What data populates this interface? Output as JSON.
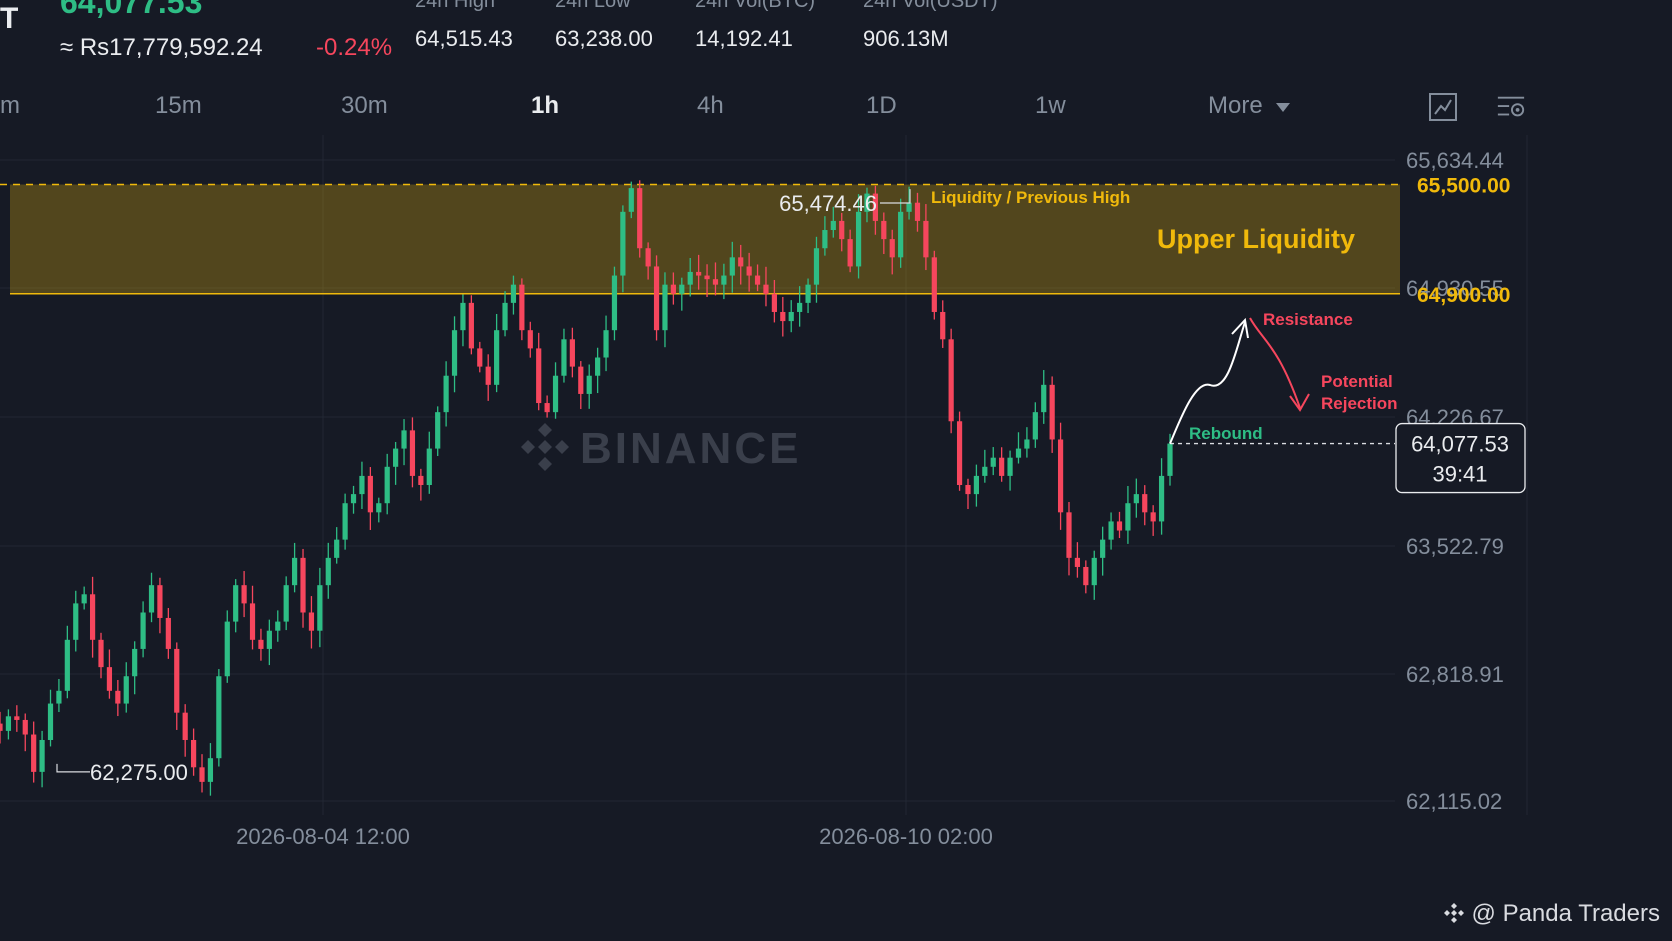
{
  "header": {
    "symbol_fragment": "T",
    "last_price": "64,077.53",
    "converted_price": "≈ Rs17,779,592.24",
    "change_percent": "-0.24%",
    "stats": [
      {
        "label": "24h High",
        "value": "64,515.43"
      },
      {
        "label": "24h Low",
        "value": "63,238.00"
      },
      {
        "label": "24h Vol(BTC)",
        "value": "14,192.41"
      },
      {
        "label": "24h Vol(USDT)",
        "value": "906.13M"
      }
    ]
  },
  "timeframes": {
    "items": [
      "m",
      "15m",
      "30m",
      "1h",
      "4h",
      "1D",
      "1w",
      "More"
    ],
    "active": "1h"
  },
  "icons": [
    "chart-type-icon",
    "chart-settings-icon",
    "dropdown-caret-icon",
    "binance-logo-icon"
  ],
  "colors": {
    "up": "#2ebd85",
    "down": "#f6465d",
    "zone": "#f0b90b",
    "bg": "#161a25"
  },
  "chart_data": {
    "type": "candlestick",
    "price_axis_ticks": [
      "65,634.44",
      "64,930.55",
      "64,226.67",
      "63,522.79",
      "62,818.91",
      "62,115.02"
    ],
    "time_axis_ticks": [
      "2026-08-04 12:00",
      "2026-08-10 02:00"
    ],
    "ylim": [
      62115.02,
      65634.44
    ],
    "grid": true,
    "levels": [
      {
        "value": 65500.0,
        "label": "65,500.00",
        "style": "dashed"
      },
      {
        "value": 64900.0,
        "label": "64,900.00",
        "style": "solid"
      }
    ],
    "zone": {
      "from": 64900.0,
      "to": 65500.0,
      "label": "Upper Liquidity"
    },
    "high_marker": {
      "value": 65474.46,
      "label": "65,474.46",
      "note": "Liquidity / Previous High"
    },
    "low_marker": {
      "value": 62275.0,
      "label": "62,275.00"
    },
    "current": {
      "value": 64077.53,
      "label": "64,077.53",
      "countdown": "39:41"
    },
    "annotations": {
      "rebound": "Rebound",
      "resistance": "Resistance",
      "rejection_line1": "Potential",
      "rejection_line2": "Rejection"
    },
    "watermark": "BINANCE",
    "path": [
      62500,
      62580,
      62560,
      62480,
      62275,
      62450,
      62650,
      62720,
      63000,
      63200,
      63250,
      63000,
      62850,
      62720,
      62650,
      62800,
      62950,
      63150,
      63300,
      63120,
      62950,
      62600,
      62450,
      62300,
      62220,
      62350,
      62800,
      63100,
      63300,
      63200,
      63000,
      62950,
      63050,
      63100,
      63300,
      63450,
      63150,
      63050,
      63300,
      63450,
      63550,
      63750,
      63800,
      63900,
      63700,
      63750,
      63950,
      64050,
      64150,
      63900,
      63850,
      64050,
      64250,
      64450,
      64700,
      64850,
      64600,
      64500,
      64400,
      64700,
      64850,
      64950,
      64700,
      64600,
      64300,
      64250,
      64450,
      64650,
      64500,
      64350,
      64450,
      64550,
      64700,
      65000,
      65350,
      65480,
      65150,
      65050,
      64700,
      64950,
      64900,
      64950,
      65020,
      65000,
      64980,
      64950,
      65000,
      65100,
      65050,
      65000,
      64950,
      64900,
      64800,
      64750,
      64800,
      64850,
      64950,
      65150,
      65250,
      65300,
      65200,
      65050,
      65350,
      65450,
      65300,
      65200,
      65100,
      65350,
      65400,
      65300,
      65100,
      64800,
      64650,
      64200,
      63850,
      63800,
      63900,
      63950,
      64000,
      63900,
      64000,
      64050,
      64100,
      64250,
      64400,
      64100,
      63700,
      63450,
      63400,
      63300,
      63450,
      63550,
      63650,
      63600,
      63750,
      63800,
      63700,
      63650,
      63900,
      64077.53
    ]
  }
}
